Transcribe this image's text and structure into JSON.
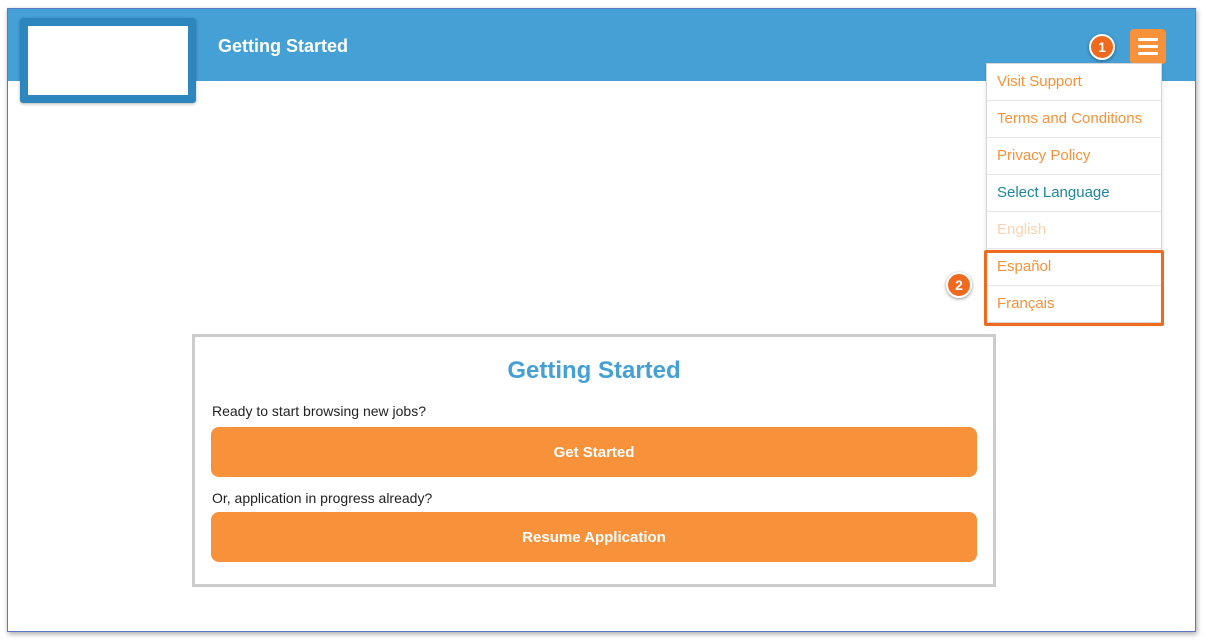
{
  "header": {
    "title": "Getting Started"
  },
  "annotations": {
    "callout_1": "1",
    "callout_2": "2"
  },
  "menu": {
    "icon": "hamburger-menu-icon",
    "items": [
      {
        "label": "Visit Support"
      },
      {
        "label": "Terms and Conditions"
      },
      {
        "label": "Privacy Policy"
      },
      {
        "label": "Select Language"
      },
      {
        "label": "English"
      },
      {
        "label": "Español"
      },
      {
        "label": "Français"
      }
    ]
  },
  "card": {
    "title": "Getting Started",
    "prompt_new": "Ready to start browsing new jobs?",
    "get_started_label": "Get Started",
    "prompt_resume": "Or, application in progress already?",
    "resume_label": "Resume Application"
  },
  "colors": {
    "header_blue": "#45a0d6",
    "accent_orange": "#f7923a",
    "callout_orange": "#ef6a1e",
    "language_header_teal": "#1d879b"
  }
}
